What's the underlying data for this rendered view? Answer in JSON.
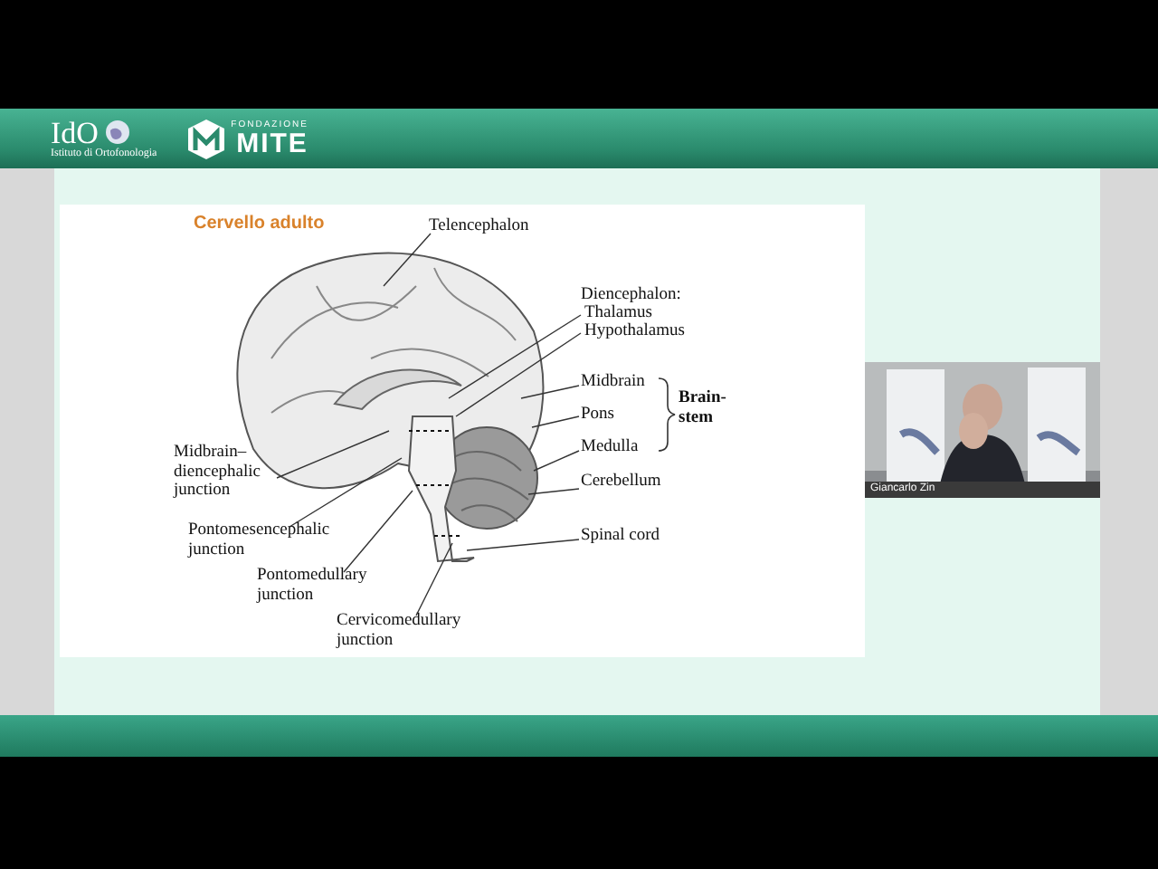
{
  "header": {
    "ido_logo": "IdO",
    "ido_subtitle": "Istituto di Ortofonologia",
    "fondazione": "FONDAZIONE",
    "mite": "MITE"
  },
  "slide": {
    "title": "Cervello adulto",
    "labels": [
      {
        "text": "Telencephalon"
      },
      {
        "text": "Diencephalon:"
      },
      {
        "text": "Thalamus"
      },
      {
        "text": "Hypothalamus"
      },
      {
        "text": "Midbrain"
      },
      {
        "text": "Pons"
      },
      {
        "text": "Medulla"
      },
      {
        "text": "Brain-\nstem"
      },
      {
        "text": "Cerebellum"
      },
      {
        "text": "Spinal cord"
      },
      {
        "text": "Midbrain–\ndiencephalic\njunction"
      },
      {
        "text": "Pontomesencephalic\njunction"
      },
      {
        "text": "Pontomedullary\njunction"
      },
      {
        "text": "Cervicomedullary\njunction"
      }
    ]
  },
  "webcam": {
    "kind": "picture",
    "name": "Giancarlo Zin"
  }
}
